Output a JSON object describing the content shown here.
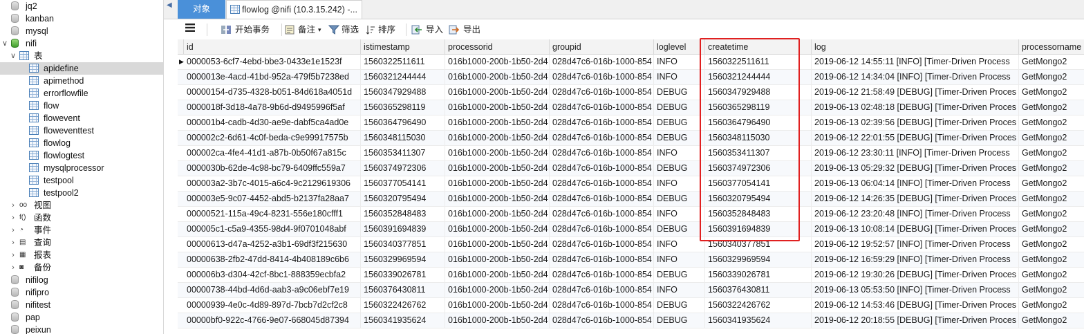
{
  "sidebar": {
    "items": [
      {
        "label": "jq2",
        "icon": "database-icon",
        "level": 0,
        "twisty": ""
      },
      {
        "label": "kanban",
        "icon": "database-icon",
        "level": 0,
        "twisty": ""
      },
      {
        "label": "mysql",
        "icon": "database-icon",
        "level": 0,
        "twisty": ""
      },
      {
        "label": "nifi",
        "icon": "database-open-icon",
        "level": 0,
        "twisty": "∨"
      },
      {
        "label": "表",
        "icon": "tables-folder-icon",
        "level": 1,
        "twisty": "∨"
      },
      {
        "label": "apidefine",
        "icon": "table-icon",
        "level": 2,
        "twisty": "",
        "selected": true
      },
      {
        "label": "apimethod",
        "icon": "table-icon",
        "level": 2,
        "twisty": ""
      },
      {
        "label": "errorflowfile",
        "icon": "table-icon",
        "level": 2,
        "twisty": ""
      },
      {
        "label": "flow",
        "icon": "table-icon",
        "level": 2,
        "twisty": ""
      },
      {
        "label": "flowevent",
        "icon": "table-icon",
        "level": 2,
        "twisty": ""
      },
      {
        "label": "floweventtest",
        "icon": "table-icon",
        "level": 2,
        "twisty": ""
      },
      {
        "label": "flowlog",
        "icon": "table-icon",
        "level": 2,
        "twisty": ""
      },
      {
        "label": "flowlogtest",
        "icon": "table-icon",
        "level": 2,
        "twisty": ""
      },
      {
        "label": "mysqlprocessor",
        "icon": "table-icon",
        "level": 2,
        "twisty": ""
      },
      {
        "label": "testpool",
        "icon": "table-icon",
        "level": 2,
        "twisty": ""
      },
      {
        "label": "testpool2",
        "icon": "table-icon",
        "level": 2,
        "twisty": ""
      },
      {
        "label": "视图",
        "icon": "views-icon",
        "level": 1,
        "twisty": "›",
        "glyph": "oo"
      },
      {
        "label": "函数",
        "icon": "function-icon",
        "level": 1,
        "twisty": "›",
        "glyph": "f()"
      },
      {
        "label": "事件",
        "icon": "event-icon",
        "level": 1,
        "twisty": "›",
        "glyph": "◔"
      },
      {
        "label": "查询",
        "icon": "query-icon",
        "level": 1,
        "twisty": "›",
        "glyph": "▤"
      },
      {
        "label": "报表",
        "icon": "report-icon",
        "level": 1,
        "twisty": "›",
        "glyph": "▦"
      },
      {
        "label": "备份",
        "icon": "backup-icon",
        "level": 1,
        "twisty": "›",
        "glyph": "◙"
      },
      {
        "label": "nifilog",
        "icon": "database-icon",
        "level": 0,
        "twisty": ""
      },
      {
        "label": "nifipro",
        "icon": "database-icon",
        "level": 0,
        "twisty": ""
      },
      {
        "label": "nifitest",
        "icon": "database-icon",
        "level": 0,
        "twisty": ""
      },
      {
        "label": "pap",
        "icon": "database-icon",
        "level": 0,
        "twisty": ""
      },
      {
        "label": "peixun",
        "icon": "database-icon",
        "level": 0,
        "twisty": ""
      }
    ]
  },
  "tabs": {
    "objects": "对象",
    "active": "flowlog @nifi (10.3.15.242) -..."
  },
  "toolbar": {
    "menu_icon": "hamburger-menu-icon",
    "begin_transaction": "开始事务",
    "memo": "备注",
    "filter": "筛选",
    "sort": "排序",
    "import": "导入",
    "export": "导出"
  },
  "grid": {
    "columns": [
      "id",
      "istimestamp",
      "processorid",
      "groupid",
      "loglevel",
      "createtime",
      "log",
      "processorname"
    ],
    "rows": [
      [
        "0000053-6cf7-4ebd-bbe3-0433e1e1523f",
        "1560322511611",
        "016b1000-200b-1b50-2d4",
        "028d47c6-016b-1000-854",
        "INFO",
        "1560322511611",
        "2019-06-12 14:55:11 [INFO] [Timer-Driven Process",
        "GetMongo2"
      ],
      [
        "0000013e-4acd-41bd-952a-479f5b7238ed",
        "1560321244444",
        "016b1000-200b-1b50-2d4",
        "028d47c6-016b-1000-854",
        "INFO",
        "1560321244444",
        "2019-06-12 14:34:04 [INFO] [Timer-Driven Process",
        "GetMongo2"
      ],
      [
        "00000154-d735-4328-b051-84d618a4051d",
        "1560347929488",
        "016b1000-200b-1b50-2d4",
        "028d47c6-016b-1000-854",
        "DEBUG",
        "1560347929488",
        "2019-06-12 21:58:49 [DEBUG] [Timer-Driven Proces",
        "GetMongo2"
      ],
      [
        "0000018f-3d18-4a78-9b6d-d9495996f5af",
        "1560365298119",
        "016b1000-200b-1b50-2d4",
        "028d47c6-016b-1000-854",
        "DEBUG",
        "1560365298119",
        "2019-06-13 02:48:18 [DEBUG] [Timer-Driven Proces",
        "GetMongo2"
      ],
      [
        "000001b4-cadb-4d30-ae9e-dabf5ca4ad0e",
        "1560364796490",
        "016b1000-200b-1b50-2d4",
        "028d47c6-016b-1000-854",
        "DEBUG",
        "1560364796490",
        "2019-06-13 02:39:56 [DEBUG] [Timer-Driven Proces",
        "GetMongo2"
      ],
      [
        "000002c2-6d61-4c0f-beda-c9e99917575b",
        "1560348115030",
        "016b1000-200b-1b50-2d4",
        "028d47c6-016b-1000-854",
        "DEBUG",
        "1560348115030",
        "2019-06-12 22:01:55 [DEBUG] [Timer-Driven Proces",
        "GetMongo2"
      ],
      [
        "000002ca-4fe4-41d1-a87b-0b50f67a815c",
        "1560353411307",
        "016b1000-200b-1b50-2d4",
        "028d47c6-016b-1000-854",
        "INFO",
        "1560353411307",
        "2019-06-12 23:30:11 [INFO] [Timer-Driven Process",
        "GetMongo2"
      ],
      [
        "0000030b-62de-4c98-bc79-6409ffc559a7",
        "1560374972306",
        "016b1000-200b-1b50-2d4",
        "028d47c6-016b-1000-854",
        "DEBUG",
        "1560374972306",
        "2019-06-13 05:29:32 [DEBUG] [Timer-Driven Proces",
        "GetMongo2"
      ],
      [
        "000003a2-3b7c-4015-a6c4-9c2129619306",
        "1560377054141",
        "016b1000-200b-1b50-2d4",
        "028d47c6-016b-1000-854",
        "INFO",
        "1560377054141",
        "2019-06-13 06:04:14 [INFO] [Timer-Driven Process",
        "GetMongo2"
      ],
      [
        "000003e5-9c07-4452-abd5-b2137fa28aa7",
        "1560320795494",
        "016b1000-200b-1b50-2d4",
        "028d47c6-016b-1000-854",
        "DEBUG",
        "1560320795494",
        "2019-06-12 14:26:35 [DEBUG] [Timer-Driven Proces",
        "GetMongo2"
      ],
      [
        "00000521-115a-49c4-8231-556e180cfff1",
        "1560352848483",
        "016b1000-200b-1b50-2d4",
        "028d47c6-016b-1000-854",
        "INFO",
        "1560352848483",
        "2019-06-12 23:20:48 [INFO] [Timer-Driven Process",
        "GetMongo2"
      ],
      [
        "000005c1-c5a9-4355-98d4-9f0701048abf",
        "1560391694839",
        "016b1000-200b-1b50-2d4",
        "028d47c6-016b-1000-854",
        "DEBUG",
        "1560391694839",
        "2019-06-13 10:08:14 [DEBUG] [Timer-Driven Proces",
        "GetMongo2"
      ],
      [
        "00000613-d47a-4252-a3b1-69df3f215630",
        "1560340377851",
        "016b1000-200b-1b50-2d4",
        "028d47c6-016b-1000-854",
        "INFO",
        "1560340377851",
        "2019-06-12 19:52:57 [INFO] [Timer-Driven Process",
        "GetMongo2"
      ],
      [
        "00000638-2fb2-47dd-8414-4b408189c6b6",
        "1560329969594",
        "016b1000-200b-1b50-2d4",
        "028d47c6-016b-1000-854",
        "INFO",
        "1560329969594",
        "2019-06-12 16:59:29 [INFO] [Timer-Driven Process",
        "GetMongo2"
      ],
      [
        "000006b3-d304-42cf-8bc1-888359ecbfa2",
        "1560339026781",
        "016b1000-200b-1b50-2d4",
        "028d47c6-016b-1000-854",
        "DEBUG",
        "1560339026781",
        "2019-06-12 19:30:26 [DEBUG] [Timer-Driven Proces",
        "GetMongo2"
      ],
      [
        "00000738-44bd-4d6d-aab3-a9c06ebf7e19",
        "1560376430811",
        "016b1000-200b-1b50-2d4",
        "028d47c6-016b-1000-854",
        "INFO",
        "1560376430811",
        "2019-06-13 05:53:50 [INFO] [Timer-Driven Process",
        "GetMongo2"
      ],
      [
        "00000939-4e0c-4d89-897d-7bcb7d2cf2c8",
        "1560322426762",
        "016b1000-200b-1b50-2d4",
        "028d47c6-016b-1000-854",
        "DEBUG",
        "1560322426762",
        "2019-06-12 14:53:46 [DEBUG] [Timer-Driven Proces",
        "GetMongo2"
      ],
      [
        "00000bf0-922c-4766-9e07-668045d87394",
        "1560341935624",
        "016b1000-200b-1b50-2d4",
        "028d47c6-016b-1000-854",
        "DEBUG",
        "1560341935624",
        "2019-06-12 20:18:55 [DEBUG] [Timer-Driven Proces",
        "GetMongo2"
      ]
    ]
  },
  "colors": {
    "tab_active_bg": "#4a90d9",
    "highlight_border": "#e02020",
    "selected_tree_bg": "#d9d9d9"
  }
}
